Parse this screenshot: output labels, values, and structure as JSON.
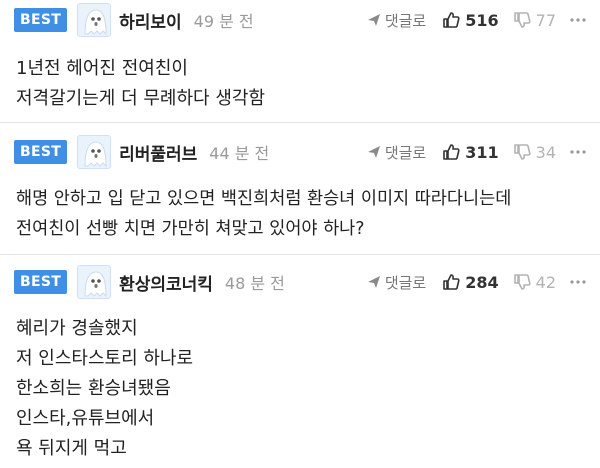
{
  "comments": [
    {
      "badge": "BEST",
      "author": "하리보이",
      "time": "49 분 전",
      "reply_label": "댓글로",
      "likes": "516",
      "dislikes": "77",
      "lines": [
        "1년전 헤어진 전여친이",
        "저격갈기는게 더 무례하다 생각함"
      ]
    },
    {
      "badge": "BEST",
      "author": "리버풀러브",
      "time": "44 분 전",
      "reply_label": "댓글로",
      "likes": "311",
      "dislikes": "34",
      "lines": [
        "해명 안하고 입 닫고 있으면 백진희처럼 환승녀 이미지 따라다니는데",
        "전여친이 선빵 치면 가만히 쳐맞고 있어야 하나?"
      ]
    },
    {
      "badge": "BEST",
      "author": "환상의코너킥",
      "time": "48 분 전",
      "reply_label": "댓글로",
      "likes": "284",
      "dislikes": "42",
      "lines": [
        "혜리가 경솔했지",
        "저 인스타스토리 하나로",
        "한소희는 환승녀됐음",
        "인스타,유튜브에서",
        "욕 뒤지게 먹고"
      ]
    }
  ],
  "icons": {
    "reply": "reply-arrow-icon",
    "like": "thumbs-up-icon",
    "dislike": "thumbs-down-icon",
    "more": "more-dots-icon",
    "avatar": "ghost-avatar-icon"
  },
  "colors": {
    "badge": "#3f8fe5",
    "divider": "#e6e6e6",
    "muted": "#9a9a9a"
  }
}
